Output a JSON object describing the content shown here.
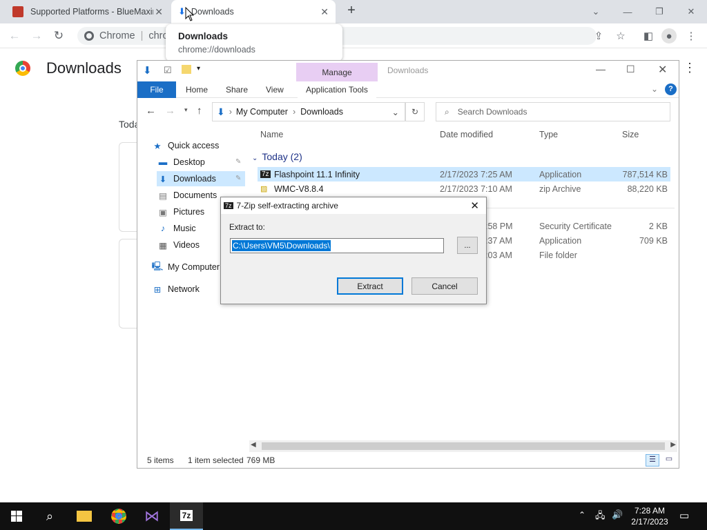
{
  "browser": {
    "tabs": [
      {
        "title": "Supported Platforms - BlueMaxima"
      },
      {
        "title": "Downloads"
      }
    ],
    "new_tab": "+",
    "omnibox": {
      "origin": "Chrome",
      "url": "chrome://downloads"
    },
    "hover_card": {
      "title": "Downloads",
      "url": "chrome://downloads"
    },
    "page_title": "Downloads",
    "today_fragment": "Toda"
  },
  "explorer": {
    "window_title": "Downloads",
    "context_tab": "Manage",
    "ribbon_tabs": [
      "File",
      "Home",
      "Share",
      "View",
      "Application Tools"
    ],
    "address": [
      "My Computer",
      "Downloads"
    ],
    "search_placeholder": "Search Downloads",
    "nav": [
      {
        "label": "Quick access",
        "icon": "star-icon"
      },
      {
        "label": "Desktop",
        "icon": "desktop-icon"
      },
      {
        "label": "Downloads",
        "icon": "download-icon"
      },
      {
        "label": "Documents",
        "icon": "documents-icon"
      },
      {
        "label": "Pictures",
        "icon": "pictures-icon"
      },
      {
        "label": "Music",
        "icon": "music-icon"
      },
      {
        "label": "Videos",
        "icon": "videos-icon"
      },
      {
        "label": "My Computer",
        "icon": "computer-icon"
      },
      {
        "label": "Network",
        "icon": "network-icon"
      }
    ],
    "columns": [
      "Name",
      "Date modified",
      "Type",
      "Size"
    ],
    "group_header": "Today (2)",
    "files": [
      {
        "name": "Flashpoint 11.1 Infinity",
        "date": "2/17/2023 7:25 AM",
        "type": "Application",
        "size": "787,514 KB"
      },
      {
        "name": "WMC-V8.8.4",
        "date": "2/17/2023 7:10 AM",
        "type": "zip Archive",
        "size": "88,220 KB"
      }
    ],
    "files_partial": [
      {
        "date": ":58 PM",
        "type": "Security Certificate",
        "size": "2 KB"
      },
      {
        "date": ":37 AM",
        "type": "Application",
        "size": "709 KB"
      },
      {
        "date": ":03 AM",
        "type": "File folder",
        "size": ""
      }
    ],
    "status": {
      "items": "5 items",
      "selected": "1 item selected",
      "size": "769 MB"
    }
  },
  "dialog": {
    "title": "7-Zip self-extracting archive",
    "label": "Extract to:",
    "path": "C:\\Users\\VM5\\Downloads\\",
    "browse": "...",
    "extract": "Extract",
    "cancel": "Cancel"
  },
  "taskbar": {
    "time": "7:28 AM",
    "date": "2/17/2023"
  },
  "colors": {
    "accent": "#1a6ec6",
    "selection": "#cce8ff",
    "context_tab": "#e8cef3"
  }
}
